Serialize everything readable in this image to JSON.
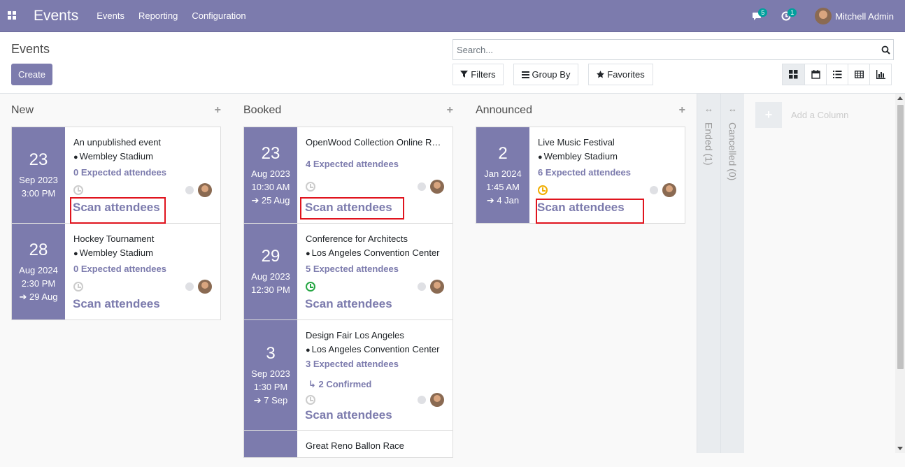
{
  "navbar": {
    "app_title": "Events",
    "menu": [
      "Events",
      "Reporting",
      "Configuration"
    ],
    "messages_count": "5",
    "activities_count": "1",
    "user_name": "Mitchell Admin"
  },
  "control": {
    "breadcrumb": "Events",
    "create_label": "Create",
    "search_placeholder": "Search...",
    "filters_label": "Filters",
    "groupby_label": "Group By",
    "favorites_label": "Favorites"
  },
  "columns": [
    {
      "title": "New",
      "cards": [
        {
          "day": "23",
          "month_year": "Sep 2023",
          "time": "3:00 PM",
          "end": "",
          "name": "An unpublished event",
          "location": "Wembley Stadium",
          "attendees": "0 Expected attendees",
          "confirmed": "",
          "scan": "Scan attendees"
        },
        {
          "day": "28",
          "month_year": "Aug 2024",
          "time": "2:30 PM",
          "end": "29 Aug",
          "name": "Hockey Tournament",
          "location": "Wembley Stadium",
          "attendees": "0 Expected attendees",
          "confirmed": "",
          "scan": "Scan attendees"
        }
      ]
    },
    {
      "title": "Booked",
      "cards": [
        {
          "day": "23",
          "month_year": "Aug 2023",
          "time": "10:30 AM",
          "end": "25 Aug",
          "name": "OpenWood Collection Online Reveal",
          "location": "",
          "attendees": "4 Expected attendees",
          "confirmed": "",
          "scan": "Scan attendees"
        },
        {
          "day": "29",
          "month_year": "Aug 2023",
          "time": "12:30 PM",
          "end": "",
          "name": "Conference for Architects",
          "location": "Los Angeles Convention Center",
          "attendees": "5 Expected attendees",
          "confirmed": "",
          "scan": "Scan attendees"
        },
        {
          "day": "3",
          "month_year": "Sep 2023",
          "time": "1:30 PM",
          "end": "7 Sep",
          "name": "Design Fair Los Angeles",
          "location": "Los Angeles Convention Center",
          "attendees": "3 Expected attendees",
          "confirmed": "2 Confirmed",
          "scan": "Scan attendees"
        },
        {
          "day": "",
          "month_year": "",
          "time": "",
          "end": "",
          "name": "Great Reno Ballon Race",
          "location": "",
          "attendees": "",
          "confirmed": "",
          "scan": ""
        }
      ]
    },
    {
      "title": "Announced",
      "cards": [
        {
          "day": "2",
          "month_year": "Jan 2024",
          "time": "1:45 AM",
          "end": "4 Jan",
          "name": "Live Music Festival",
          "location": "Wembley Stadium",
          "attendees": "6 Expected attendees",
          "confirmed": "",
          "scan": "Scan attendees"
        }
      ]
    }
  ],
  "folded_columns": [
    "Ended (1)",
    "Cancelled (0)"
  ],
  "add_column_label": "Add a Column",
  "colors": {
    "brand": "#7c7bad",
    "highlight": "#e0141e"
  }
}
